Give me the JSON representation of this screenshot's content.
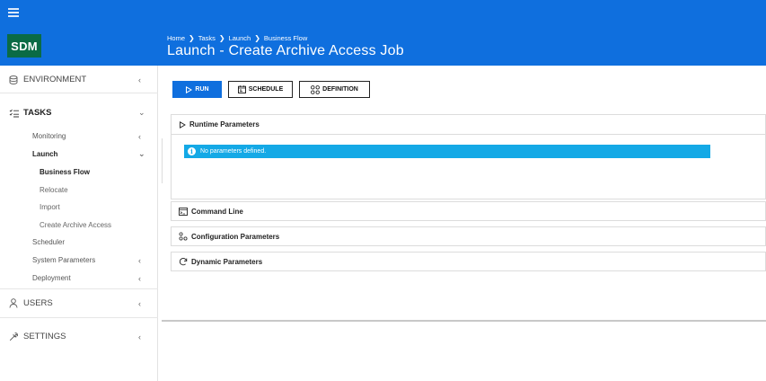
{
  "header": {
    "logo": "SDM",
    "breadcrumb": [
      "Home",
      "Tasks",
      "Launch",
      "Business Flow"
    ],
    "breadcrumb_sep": "❯",
    "title": "Launch - Create Archive Access Job"
  },
  "sidebar": {
    "environment": "ENVIRONMENT",
    "tasks": "TASKS",
    "monitoring": "Monitoring",
    "launch": "Launch",
    "business_flow": "Business Flow",
    "relocate": "Relocate",
    "import": "Import",
    "create_archive_access": "Create Archive Access",
    "scheduler": "Scheduler",
    "system_parameters": "System Parameters",
    "deployment": "Deployment",
    "users": "USERS",
    "settings": "SETTINGS",
    "chev_left": "‹",
    "chev_down": "⌄"
  },
  "toolbar": {
    "run_label": "RUN",
    "schedule_label": "SCHEDULE",
    "definition_label": "DEFINITION"
  },
  "sections": {
    "runtime": "Runtime Parameters",
    "info_message": "No parameters defined.",
    "command_line": "Command Line",
    "configuration": "Configuration Parameters",
    "dynamic": "Dynamic Parameters"
  },
  "colors": {
    "header_blue": "#0f6fde",
    "logo_green": "#0a6b45",
    "info_blue": "#14a9e6"
  }
}
